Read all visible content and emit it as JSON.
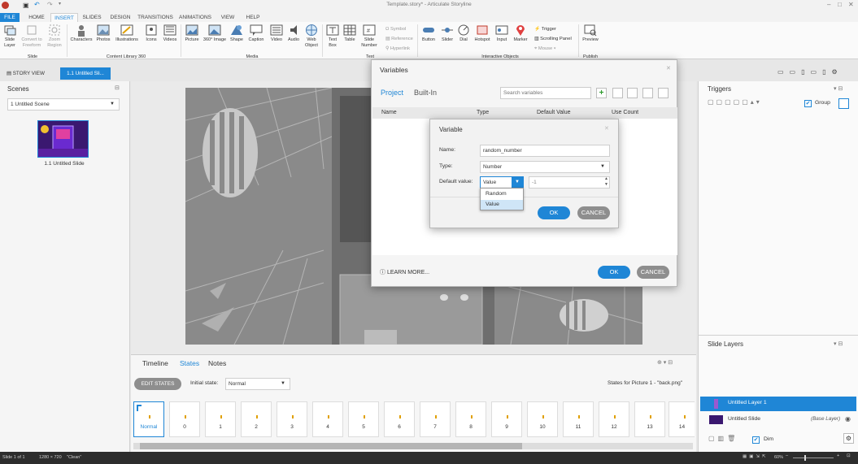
{
  "window": {
    "title": "Template.story* - Articulate Storyline"
  },
  "menu_tabs": [
    "FILE",
    "HOME",
    "INSERT",
    "SLIDES",
    "DESIGN",
    "TRANSITIONS",
    "ANIMATIONS",
    "VIEW",
    "HELP"
  ],
  "ribbon": {
    "slide_group": [
      "Slide Layer",
      "Convert to Freeform",
      "Zoom Region"
    ],
    "slide_group_label": "Slide",
    "content_group": [
      "Characters",
      "Photos",
      "Illustrations",
      "Icons",
      "Videos"
    ],
    "content_group_label": "Content Library 360",
    "media_group": [
      "Picture",
      "360° Image",
      "Shape",
      "Caption",
      "Video",
      "Audio",
      "Web Object"
    ],
    "media_group_label": "Media",
    "text_group": [
      "Text Box",
      "Table",
      "Slide Number"
    ],
    "text_group_label": "Text",
    "text_small": [
      "Symbol",
      "Reference",
      "Hyperlink"
    ],
    "interactive_group": [
      "Button",
      "Slider",
      "Dial",
      "Hotspot",
      "Input",
      "Marker"
    ],
    "interactive_group_label": "Interactive Objects",
    "interactive_small": [
      "Trigger",
      "Scrolling Panel",
      "Mouse"
    ],
    "publish_group": [
      "Preview"
    ],
    "publish_group_label": "Publish"
  },
  "doc_tabs": {
    "story_view": "STORY VIEW",
    "current": "1.1 Untitled Sli..."
  },
  "scenes": {
    "title": "Scenes",
    "selected_scene": "1 Untitled Scene",
    "thumb_label": "1.1 Untitled Slide"
  },
  "variables_dialog": {
    "title": "Variables",
    "tabs": [
      "Project",
      "Built-In"
    ],
    "search_placeholder": "Search variables",
    "columns": [
      "Name",
      "Type",
      "Default Value",
      "Use Count"
    ],
    "learn_more": "LEARN MORE...",
    "ok": "OK",
    "cancel": "CANCEL"
  },
  "variable_dialog": {
    "title": "Variable",
    "name_label": "Name:",
    "name_value": "random_number",
    "type_label": "Type:",
    "type_value": "Number",
    "default_label": "Default value:",
    "default_mode": "Value",
    "default_value": "-1",
    "options": [
      "Random",
      "Value"
    ],
    "ok": "OK",
    "cancel": "CANCEL"
  },
  "bottom": {
    "tabs": [
      "Timeline",
      "States",
      "Notes"
    ],
    "edit_states": "EDIT STATES",
    "initial_state_label": "Initial state:",
    "initial_state_value": "Normal",
    "states_for": "States for Picture 1 - \"back.png\"",
    "states": [
      "Normal",
      "0",
      "1",
      "2",
      "3",
      "4",
      "5",
      "6",
      "7",
      "8",
      "9",
      "10",
      "11",
      "12",
      "13",
      "14"
    ]
  },
  "triggers": {
    "title": "Triggers",
    "group_label": "Group"
  },
  "slide_layers": {
    "title": "Slide Layers",
    "layers": [
      {
        "name": "Untitled Layer 1",
        "note": ""
      },
      {
        "name": "Untitled Slide",
        "note": "(Base Layer)"
      }
    ],
    "dim_label": "Dim"
  },
  "statusbar": {
    "slide": "Slide 1 of 1",
    "size": "1280 × 720",
    "theme": "\"Clean\"",
    "zoom": "60%"
  },
  "colors": {
    "accent": "#1f86d6",
    "ok_button": "#1f86d6",
    "cancel_button": "#8e8e8e",
    "file_tab": "#1f86d6",
    "selected_layer": "#1f86d6"
  }
}
